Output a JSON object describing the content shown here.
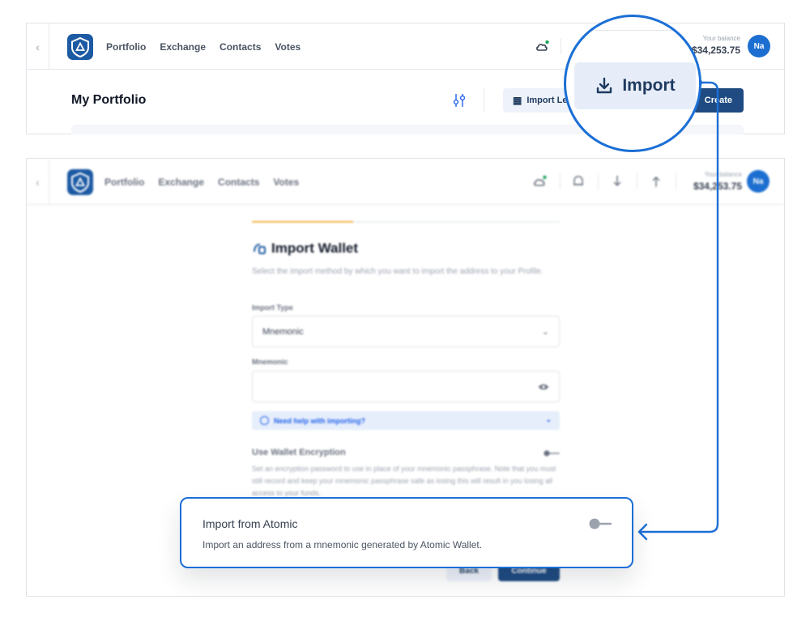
{
  "app": {
    "nav_links": [
      "Portfolio",
      "Exchange",
      "Contacts",
      "Votes"
    ],
    "balance_label": "Your balance",
    "balance_value": "$34,253.75",
    "avatar_initials": "Na",
    "brand_color": "#1c5aa3",
    "accent_color": "#1b6fd6"
  },
  "portfolio": {
    "title": "My Portfolio",
    "import_ledger_label": "Import Le",
    "create_label": "Create"
  },
  "zoom": {
    "import_label": "Import"
  },
  "import_wallet": {
    "title": "Import Wallet",
    "description": "Select the import method by which you want to import the address to your Profile.",
    "import_type_label": "Import Type",
    "import_type_value": "Mnemonic",
    "mnemonic_label": "Mnemonic",
    "mnemonic_value": "",
    "help_text": "Need help with importing?",
    "encryption_title": "Use Wallet Encryption",
    "encryption_desc": "Set an encryption password to use in place of your mnemonic passphrase. Note that you must still record and keep your mnemonic passphrase safe as losing this will result in you losing all access to your funds.",
    "back_label": "Back",
    "continue_label": "Continue",
    "progress": 0.33
  },
  "callout": {
    "title": "Import from Atomic",
    "description": "Import an address from a mnemonic generated by Atomic Wallet.",
    "toggle_on": false
  }
}
